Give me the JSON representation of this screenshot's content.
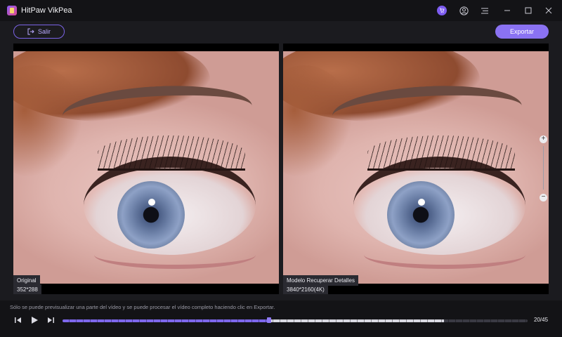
{
  "app": {
    "title": "HitPaw VikPea"
  },
  "toolbar": {
    "exit_label": "Salir",
    "export_label": "Exportar"
  },
  "preview": {
    "original": {
      "name": "Original",
      "resolution": "352*288"
    },
    "enhanced": {
      "name": "Modelo Recuperar Detalles",
      "resolution": "3840*2160(4K)"
    }
  },
  "hint": "Sólo se puede previsualizar una parte del vídeo y se puede procesar el vídeo completo haciendo clic en Exportar.",
  "playback": {
    "counter": "20/45",
    "current_frame": 20,
    "total_frames": 45,
    "processed_window_end_fraction": 0.82
  },
  "colors": {
    "accent": "#8a72f2",
    "background": "#1b1b1f",
    "titlebar": "#131316"
  },
  "icons": [
    "cart-icon",
    "user-icon",
    "menu-icon",
    "minimize-icon",
    "maximize-icon",
    "close-icon",
    "exit-icon",
    "zoom-in-icon",
    "zoom-out-icon",
    "prev-frame-icon",
    "play-icon",
    "next-frame-icon"
  ]
}
